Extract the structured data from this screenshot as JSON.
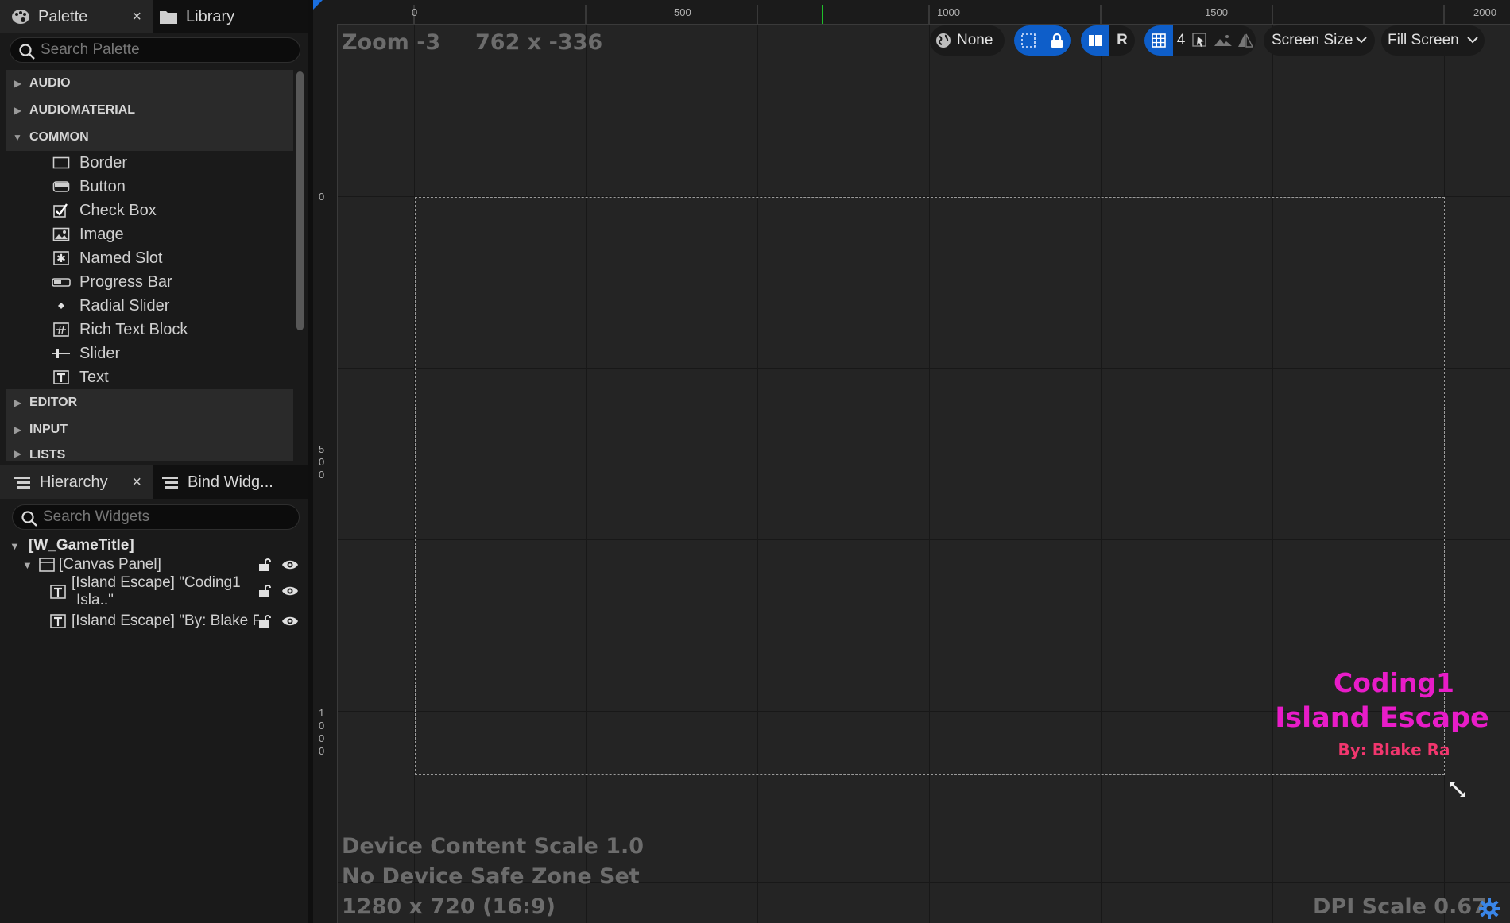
{
  "palette": {
    "tab_label": "Palette",
    "close_glyph": "×",
    "library_tab_label": "Library",
    "search_placeholder": "Search Palette",
    "categories_top": [
      {
        "label": "AUDIO",
        "expanded": false
      },
      {
        "label": "AUDIOMATERIAL",
        "expanded": false
      },
      {
        "label": "COMMON",
        "expanded": true
      }
    ],
    "common_items": [
      {
        "label": "Border",
        "icon": "border-icon"
      },
      {
        "label": "Button",
        "icon": "button-icon"
      },
      {
        "label": "Check Box",
        "icon": "checkbox-icon"
      },
      {
        "label": "Image",
        "icon": "image-icon"
      },
      {
        "label": "Named Slot",
        "icon": "named-slot-icon"
      },
      {
        "label": "Progress Bar",
        "icon": "progress-bar-icon"
      },
      {
        "label": "Radial Slider",
        "icon": "radial-slider-icon"
      },
      {
        "label": "Rich Text Block",
        "icon": "rich-text-icon"
      },
      {
        "label": "Slider",
        "icon": "slider-icon"
      },
      {
        "label": "Text",
        "icon": "text-icon"
      }
    ],
    "categories_bottom": [
      {
        "label": "EDITOR",
        "expanded": false
      },
      {
        "label": "INPUT",
        "expanded": false
      },
      {
        "label": "LISTS",
        "expanded": false
      }
    ]
  },
  "hierarchy": {
    "tab_label": "Hierarchy",
    "close_glyph": "×",
    "bind_tab_label": "Bind Widg...",
    "search_placeholder": "Search Widgets",
    "root_label": "[W_GameTitle]",
    "canvas_label": "[Canvas Panel]",
    "text1_line1": "[Island Escape] \"Coding1",
    "text1_line2": "Isla..\"",
    "text2_label": "[Island Escape] \"By: Blake F"
  },
  "viewport": {
    "zoom_label": "Zoom -3",
    "cursor_coords": "762 x -336",
    "ruler_h_labels": [
      "0",
      "500",
      "1000",
      "1500",
      "2000"
    ],
    "ruler_v_labels": [
      "0",
      "5\n0\n0",
      "1\n0\n0\n0"
    ],
    "toolbar": {
      "localize_value": "None",
      "respect_locks_label": "R",
      "grid_snap_value": "4",
      "screen_size_label": "Screen Size",
      "fill_screen_label": "Fill Screen"
    },
    "game_title_line1": "Coding1",
    "game_title_line2": "Island Escape",
    "game_byline": "By: Blake Ra",
    "device_scale": "Device Content Scale 1.0",
    "safe_zone": "No Device Safe Zone Set",
    "resolution": "1280 x 720 (16:9)",
    "dpi_scale": "DPI Scale 0.67"
  },
  "colors": {
    "accent_blue": "#0e5ec9",
    "title_magenta": "#e81cc8",
    "byline_red": "#f2366e",
    "green_marker": "#1fbf2a"
  }
}
